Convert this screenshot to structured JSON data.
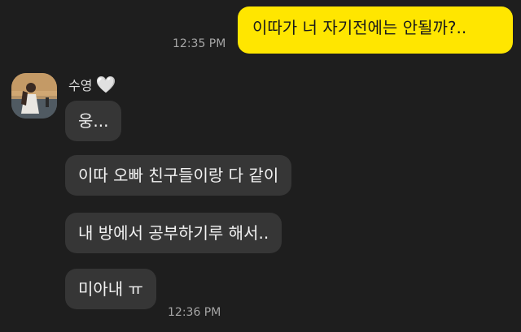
{
  "conversation": {
    "outgoing": [
      {
        "text": "이따가 너 자기전에는 안될까?..",
        "time": "12:35 PM"
      }
    ],
    "contact": {
      "name": "수영",
      "heart": "🤍",
      "avatar_icon": "profile-photo"
    },
    "incoming": [
      {
        "text": "웅..."
      },
      {
        "text": "이따 오빠 친구들이랑 다 같이"
      },
      {
        "text": "내 방에서 공부하기루 해서.."
      },
      {
        "text": "미아내 ㅠ"
      }
    ],
    "incoming_time": "12:36 PM"
  },
  "colors": {
    "background": "#1e1e1e",
    "outgoing_bubble": "#ffe600",
    "incoming_bubble": "#363636",
    "timestamp": "#a6a6a6"
  }
}
